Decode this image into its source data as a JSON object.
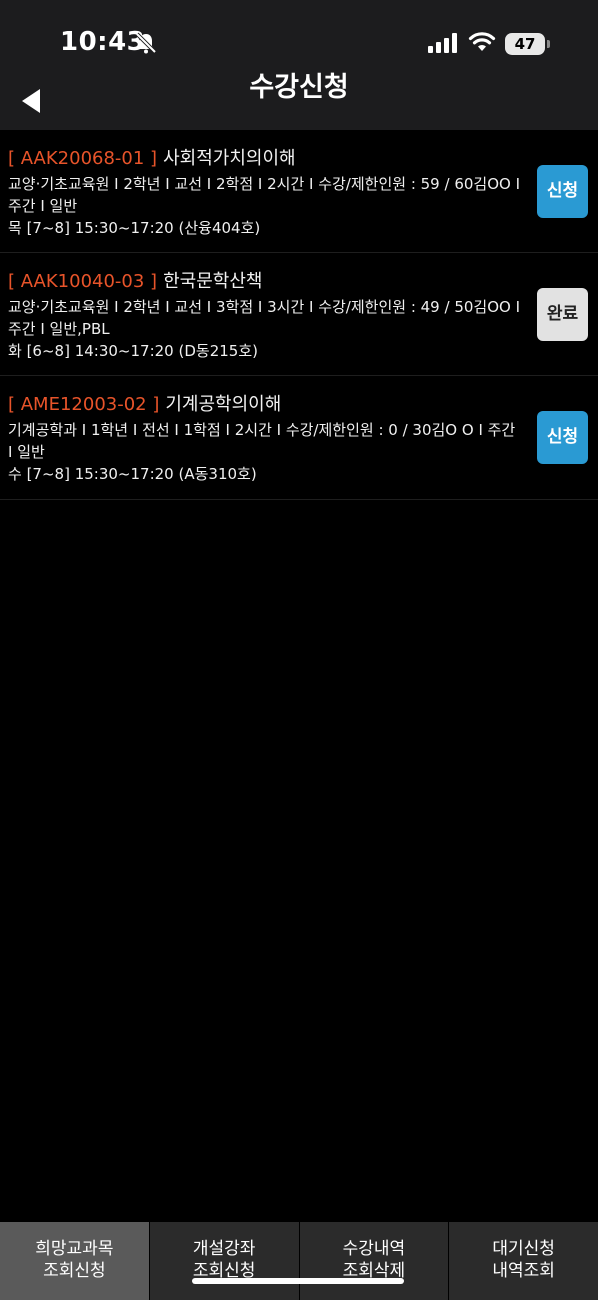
{
  "status_bar": {
    "time": "10:43",
    "battery_level": "47"
  },
  "nav": {
    "title": "수강신청"
  },
  "courses": [
    {
      "code": "[ AAK20068-01 ]",
      "name": "사회적가치의이해",
      "detail": "교양·기초교육원 I 2학년 I 교선 I 2학점 I 2시간 I 수강/제한인원 : 59 / 60김OO I 주간 I 일반",
      "schedule": "목 [7~8] 15:30~17:20 (산융404호)",
      "action": "신청"
    },
    {
      "code": "[ AAK10040-03 ]",
      "name": "한국문학산책",
      "detail": "교양·기초교육원 I 2학년 I 교선 I 3학점 I 3시간 I 수강/제한인원 : 49 / 50김OO I 주간 I 일반,PBL",
      "schedule": "화 [6~8] 14:30~17:20 (D동215호)",
      "action": "완료"
    },
    {
      "code": "[ AME12003-02 ]",
      "name": "기계공학의이해",
      "detail": "기계공학과 I 1학년 I 전선 I 1학점 I 2시간 I 수강/제한인원 : 0 / 30김O O I 주간 I 일반",
      "schedule": "수 [7~8] 15:30~17:20 (A동310호)",
      "action": "신청"
    }
  ],
  "tabs": [
    {
      "line1": "희망교과목",
      "line2": "조회신청"
    },
    {
      "line1": "개설강좌",
      "line2": "조회신청"
    },
    {
      "line1": "수강내역",
      "line2": "조회삭제"
    },
    {
      "line1": "대기신청",
      "line2": "내역조회"
    }
  ],
  "colors": {
    "course_code": "#e8542a",
    "apply_button": "#2a9ad3",
    "done_button": "#e2e2e2",
    "active_tab": "#5a5a5a",
    "tab_bar": "#2b2b2b"
  },
  "icons": {
    "back": "back-arrow-icon",
    "bell": "bell-slash-icon",
    "signal": "cellular-signal-icon",
    "wifi": "wifi-icon",
    "battery": "battery-icon"
  }
}
